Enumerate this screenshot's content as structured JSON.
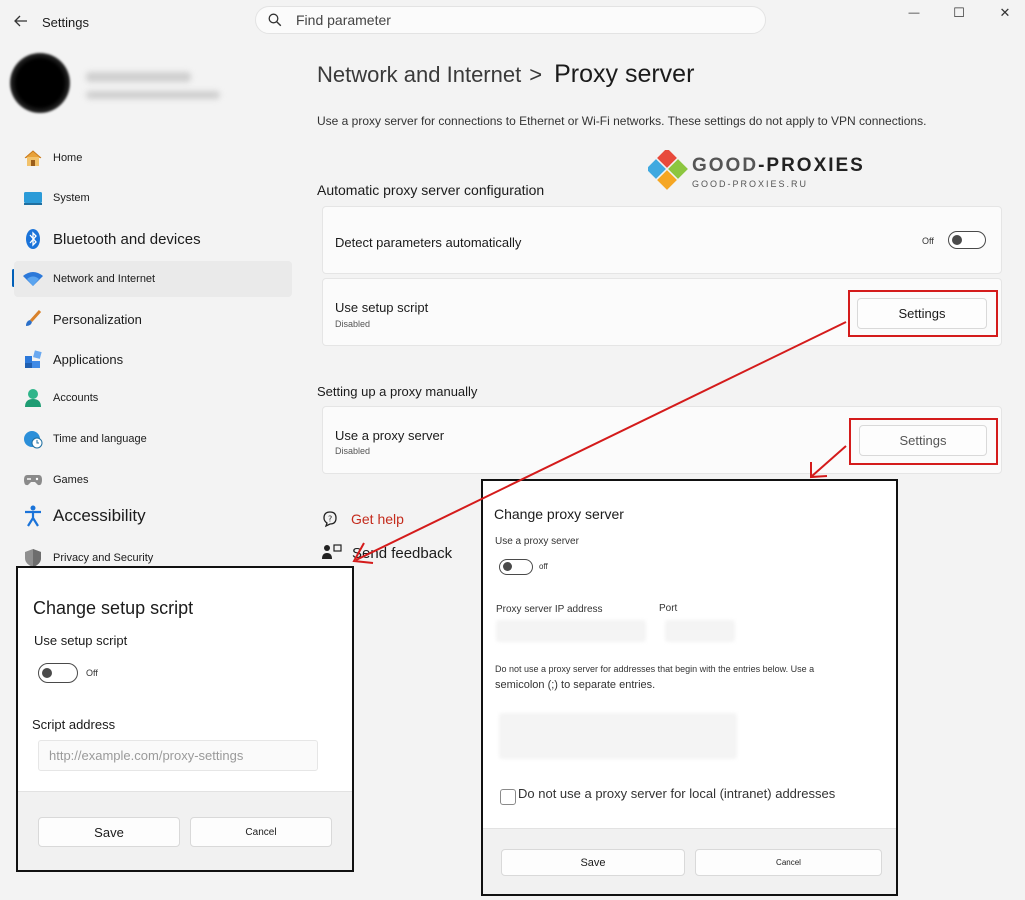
{
  "window": {
    "title": "Settings",
    "controls": {
      "minimize": "—",
      "maximize": "☐",
      "close": "✕"
    }
  },
  "search": {
    "placeholder": "Find parameter"
  },
  "sidebar": {
    "items": [
      {
        "label": "Home"
      },
      {
        "label": "System"
      },
      {
        "label": "Bluetooth and devices"
      },
      {
        "label": "Network and Internet"
      },
      {
        "label": "Personalization"
      },
      {
        "label": "Applications"
      },
      {
        "label": "Accounts"
      },
      {
        "label": "Time and language"
      },
      {
        "label": "Games"
      },
      {
        "label": "Accessibility"
      },
      {
        "label": "Privacy and Security"
      }
    ]
  },
  "breadcrumb": {
    "parent": "Network and Internet",
    "separator": ">",
    "current": "Proxy server"
  },
  "description": "Use a proxy server for connections to Ethernet or Wi-Fi networks. These settings do not apply to VPN connections.",
  "watermark": {
    "brand_a": "GOOD",
    "brand_b": "-PROXIES",
    "domain": "GOOD-PROXIES.RU"
  },
  "auto_section": {
    "title": "Automatic proxy server configuration",
    "detect": {
      "label": "Detect parameters automatically",
      "state": "Off"
    },
    "script": {
      "label": "Use setup script",
      "sub": "Disabled",
      "button": "Settings"
    }
  },
  "manual_section": {
    "title": "Setting up a proxy manually",
    "proxy": {
      "label": "Use a proxy server",
      "sub": "Disabled",
      "button": "Settings"
    }
  },
  "help": {
    "get_help": "Get help",
    "send_feedback": "Send feedback"
  },
  "dialog_script": {
    "title": "Change setup script",
    "toggle_label": "Use setup script",
    "toggle_state": "Off",
    "address_label": "Script address",
    "address_placeholder": "http://example.com/proxy-settings",
    "save": "Save",
    "cancel": "Cancel"
  },
  "dialog_proxy": {
    "title": "Change proxy server",
    "toggle_label": "Use a proxy server",
    "toggle_state": "off",
    "ip_label": "Proxy server IP address",
    "port_label": "Port",
    "exceptions_text_1": "Do not use a proxy server for addresses that begin with the entries below. Use a",
    "exceptions_text_2": "semicolon (;) to separate entries.",
    "local_checkbox": "Do not use a proxy server for local (intranet) addresses",
    "save": "Save",
    "cancel": "Cancel"
  },
  "colors": {
    "accent": "#005fb8",
    "highlight": "#d41b1b",
    "link": "#c42b1c"
  }
}
